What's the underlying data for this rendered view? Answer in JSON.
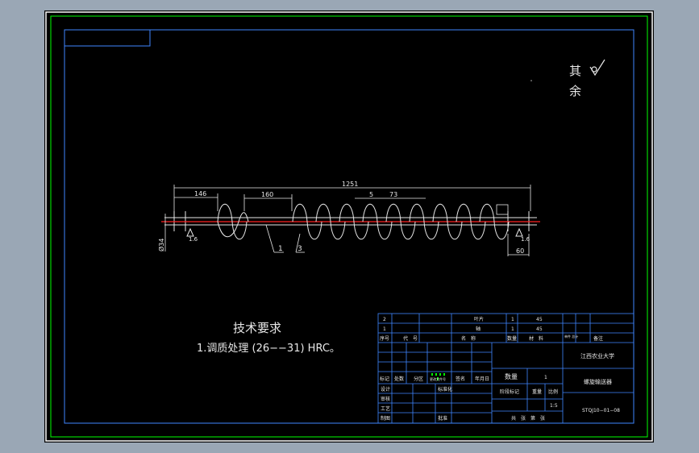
{
  "colors": {
    "frame_bg": "#8f9eae",
    "paper": "#000000",
    "outer_border": "#ffffff",
    "green_border": "#00ff00",
    "drawing_line": "#ffffff",
    "title_block_line": "#3f86ff",
    "centerline": "#ff2020",
    "text": "#e8e8e8"
  },
  "surface_note": {
    "prefix_1": "其",
    "prefix_2": "余",
    "symbol": "√"
  },
  "dimensions": {
    "overall": "1251",
    "left_part": "146",
    "second_part": "160",
    "small_gap": "5",
    "pitch": "73",
    "diameter": "Ø34",
    "right_end": "60",
    "right_label": "1.6",
    "left_label": "1.6"
  },
  "callouts": {
    "c1": "1",
    "c3": "3"
  },
  "tech_requirements": {
    "title": "技术要求",
    "item1": "1.调质处理 (26−−31) HRC。"
  },
  "title_block": {
    "rows": [
      {
        "no": "2",
        "name": "叶片",
        "qty": "1",
        "material": "45"
      },
      {
        "no": "1",
        "name": "轴",
        "qty": "1",
        "material": "45"
      }
    ],
    "header": {
      "no": "序号",
      "code": "代　号",
      "name": "名　称",
      "qty": "数量",
      "material": "材　料",
      "weight": "单件 总计",
      "note": "备注"
    },
    "school": "江西农业大学",
    "drawing_name": "螺旋输送器",
    "drawing_no": "STQJ10−01−08",
    "qty_label": "数量",
    "qty_value": "1",
    "stage_label": "阶段标记",
    "weight_label": "重量",
    "scale_label": "比例",
    "scale_value": "1:5",
    "sheet_info": "共　张　第　张",
    "labels": {
      "mark": "标记",
      "count": "处数",
      "zone": "分区",
      "change_doc": "更改文件号",
      "sign": "签名",
      "date": "年月日",
      "design": "设计",
      "std": "标准化",
      "check": "审核",
      "process": "工艺",
      "approve": "批准",
      "drafter": "制图"
    }
  }
}
